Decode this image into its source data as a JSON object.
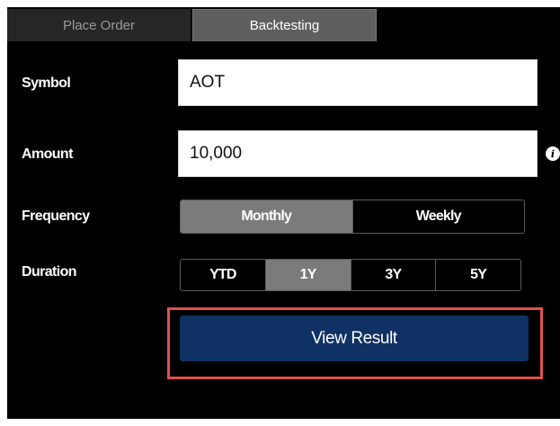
{
  "tabs": [
    {
      "label": "Place Order",
      "active": false
    },
    {
      "label": "Backtesting",
      "active": true
    }
  ],
  "form": {
    "symbol": {
      "label": "Symbol",
      "value": "AOT"
    },
    "amount": {
      "label": "Amount",
      "value": "10,000",
      "info_icon": "info-icon"
    },
    "frequency": {
      "label": "Frequency",
      "options": [
        "Monthly",
        "Weekly"
      ],
      "selected": "Monthly"
    },
    "duration": {
      "label": "Duration",
      "options": [
        "YTD",
        "1Y",
        "3Y",
        "5Y"
      ],
      "selected": "1Y"
    }
  },
  "action": {
    "view_result_label": "View Result"
  },
  "colors": {
    "background": "#000000",
    "tab_active": "#5f5f5f",
    "tab_inactive": "#262626",
    "segment_active": "#7b7b7b",
    "primary_button": "#0f3163",
    "highlight": "#e0504f"
  }
}
